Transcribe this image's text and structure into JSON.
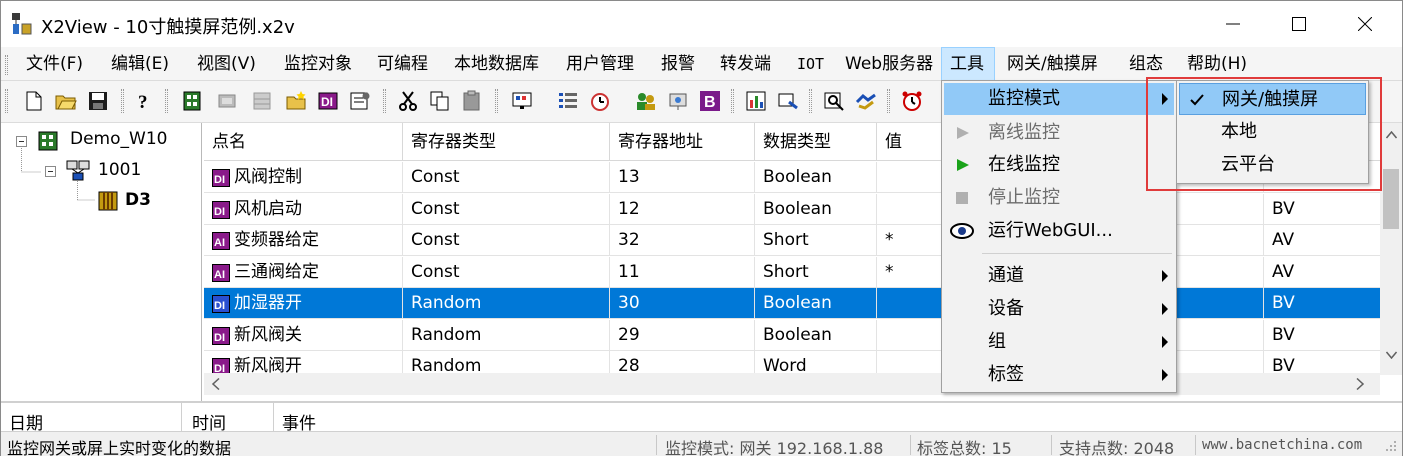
{
  "window": {
    "title": "X2View - 10寸触摸屏范例.x2v",
    "minimize": "minimize",
    "maximize": "maximize",
    "close": "close"
  },
  "menubar": [
    "文件(F)",
    "编辑(E)",
    "视图(V)",
    "监控对象",
    "可编程",
    "本地数据库",
    "用户管理",
    "报警",
    "转发端",
    "IOT",
    "Web服务器",
    "工具",
    "网关/触摸屏",
    "组态",
    "帮助(H)"
  ],
  "tree": {
    "root": "Demo_W10",
    "child": "1001",
    "leaf": "D3"
  },
  "grid": {
    "headers": [
      "点名",
      "寄存器类型",
      "寄存器地址",
      "数据类型",
      "值"
    ],
    "hidden_type_col": "",
    "rows": [
      {
        "icon": "DI",
        "name": "风阀控制",
        "regtype": "Const",
        "addr": "13",
        "dtype": "Boolean",
        "value": "",
        "type": "BV"
      },
      {
        "icon": "DI",
        "name": "风机启动",
        "regtype": "Const",
        "addr": "12",
        "dtype": "Boolean",
        "value": "",
        "type": "BV"
      },
      {
        "icon": "AI",
        "name": "变频器给定",
        "regtype": "Const",
        "addr": "32",
        "dtype": "Short",
        "value": "*",
        "type": "AV"
      },
      {
        "icon": "AI",
        "name": "三通阀给定",
        "regtype": "Const",
        "addr": "11",
        "dtype": "Short",
        "value": "*",
        "type": "AV"
      },
      {
        "icon": "DI",
        "name": "加湿器开",
        "regtype": "Random",
        "addr": "30",
        "dtype": "Boolean",
        "value": "",
        "type": "BV"
      },
      {
        "icon": "DI",
        "name": "新风阀关",
        "regtype": "Random",
        "addr": "29",
        "dtype": "Boolean",
        "value": "",
        "type": "BV"
      },
      {
        "icon": "DI",
        "name": "新风阀开",
        "regtype": "Random",
        "addr": "28",
        "dtype": "Word",
        "value": "",
        "type": "BV"
      }
    ]
  },
  "events": {
    "headers": [
      "日期",
      "时间",
      "事件"
    ]
  },
  "status": {
    "hint": "监控网关或屏上实时变化的数据",
    "mode": "监控模式: 网关 192.168.1.88",
    "tags": "标签总数: 15",
    "points": "支持点数: 2048",
    "site": "www.bacnetchina.com"
  },
  "tools_menu": {
    "items": [
      {
        "label": "监控模式",
        "state": "highlighted",
        "submenu": true
      },
      {
        "label": "离线监控",
        "state": "disabled",
        "submenu": false
      },
      {
        "label": "在线监控",
        "state": "enabled",
        "submenu": false
      },
      {
        "label": "停止监控",
        "state": "disabled",
        "submenu": false
      },
      {
        "label": "运行WebGUI...",
        "state": "enabled",
        "submenu": false
      },
      {
        "label": "通道",
        "state": "enabled",
        "submenu": true
      },
      {
        "label": "设备",
        "state": "enabled",
        "submenu": true
      },
      {
        "label": "组",
        "state": "enabled",
        "submenu": true
      },
      {
        "label": "标签",
        "state": "enabled",
        "submenu": true
      }
    ]
  },
  "mode_submenu": {
    "items": [
      {
        "label": "网关/触摸屏",
        "checked": true
      },
      {
        "label": "本地",
        "checked": false
      },
      {
        "label": "云平台",
        "checked": false
      }
    ]
  },
  "colors": {
    "selection": "#0078d7",
    "menu_highlight": "#91c9f7",
    "callout": "#e03b3b",
    "play_green": "#1aa31a"
  }
}
